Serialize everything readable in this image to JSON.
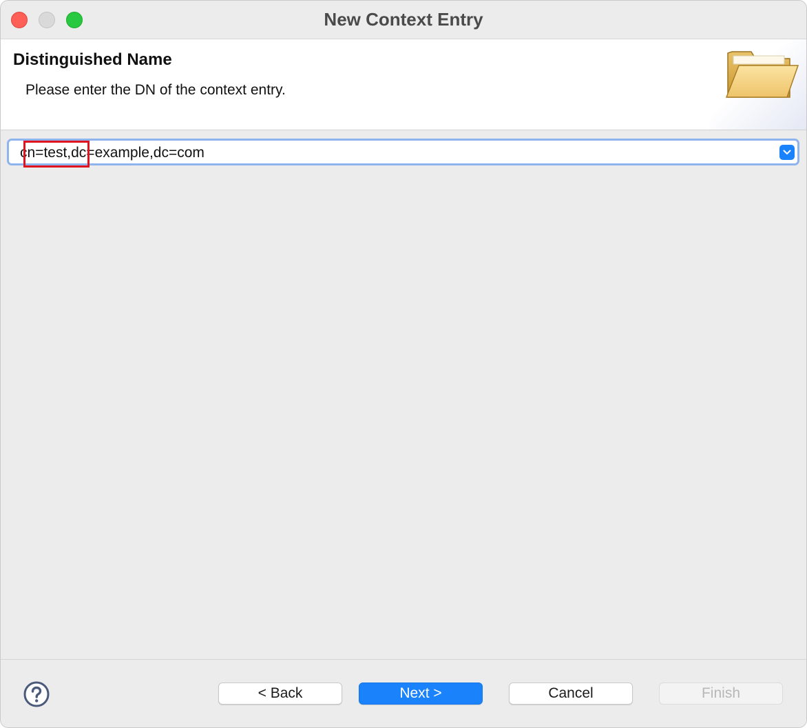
{
  "window": {
    "title": "New Context Entry"
  },
  "header": {
    "title": "Distinguished Name",
    "description": "Please enter the DN of the context entry."
  },
  "dn_field": {
    "value_rdn": "cn=test",
    "value_rest": ",dc=example,dc=com",
    "highlight_color": "#e0141e"
  },
  "footer": {
    "help_icon": "help-icon",
    "back_label": "< Back",
    "next_label": "Next >",
    "cancel_label": "Cancel",
    "finish_label": "Finish",
    "accent_color": "#1a82fb"
  }
}
